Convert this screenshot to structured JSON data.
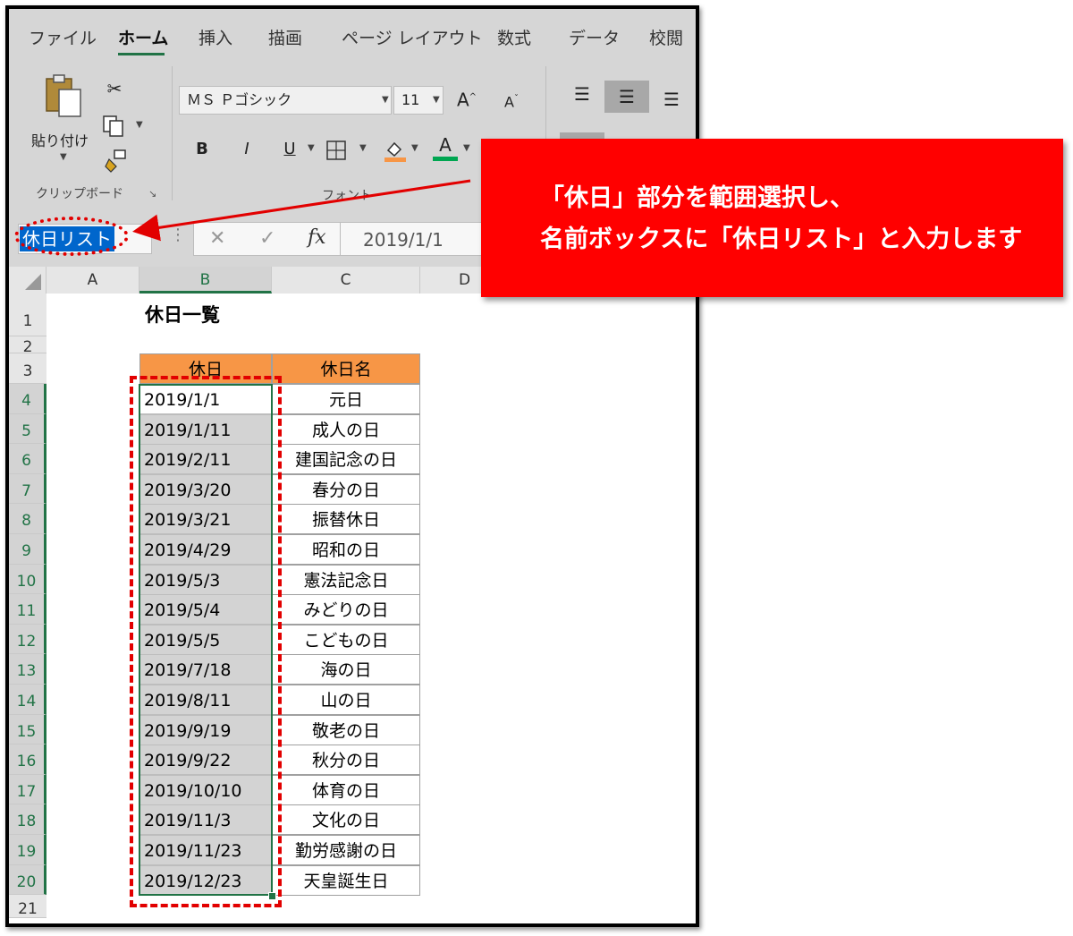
{
  "ribbon": {
    "tabs": [
      "ファイル",
      "ホーム",
      "挿入",
      "描画",
      "ページ レイアウト",
      "数式",
      "データ",
      "校閲"
    ],
    "active_tab": "ホーム",
    "clipboard": {
      "paste_label": "貼り付け",
      "group_label": "クリップボード"
    },
    "font": {
      "family": "ＭＳ Ｐゴシック",
      "size": "11",
      "group_label": "フォント",
      "bold": "B",
      "italic": "I",
      "underline": "U",
      "grow": "A",
      "shrink": "A",
      "font_color": "A"
    },
    "accent_color": "#217346"
  },
  "formula_bar": {
    "name_box": "休日リスト",
    "cancel": "✕",
    "enter": "✓",
    "fx": "fx",
    "formula": "2019/1/1"
  },
  "sheet": {
    "columns": [
      "A",
      "B",
      "C",
      "D"
    ],
    "rows": [
      "1",
      "2",
      "3",
      "4",
      "5",
      "6",
      "7",
      "8",
      "9",
      "10",
      "11",
      "12",
      "13",
      "14",
      "15",
      "16",
      "17",
      "18",
      "19",
      "20",
      "21"
    ],
    "title": "休日一覧",
    "headers": {
      "date": "休日",
      "name": "休日名"
    },
    "header_color": "#f79646",
    "holidays": [
      {
        "date": "2019/1/1",
        "name": "元日"
      },
      {
        "date": "2019/1/11",
        "name": "成人の日"
      },
      {
        "date": "2019/2/11",
        "name": "建国記念の日"
      },
      {
        "date": "2019/3/20",
        "name": "春分の日"
      },
      {
        "date": "2019/3/21",
        "name": "振替休日"
      },
      {
        "date": "2019/4/29",
        "name": "昭和の日"
      },
      {
        "date": "2019/5/3",
        "name": "憲法記念日"
      },
      {
        "date": "2019/5/4",
        "name": "みどりの日"
      },
      {
        "date": "2019/5/5",
        "name": "こどもの日"
      },
      {
        "date": "2019/7/18",
        "name": "海の日"
      },
      {
        "date": "2019/8/11",
        "name": "山の日"
      },
      {
        "date": "2019/9/19",
        "name": "敬老の日"
      },
      {
        "date": "2019/9/22",
        "name": "秋分の日"
      },
      {
        "date": "2019/10/10",
        "name": "体育の日"
      },
      {
        "date": "2019/11/3",
        "name": "文化の日"
      },
      {
        "date": "2019/11/23",
        "name": "勤労感謝の日"
      },
      {
        "date": "2019/12/23",
        "name": "天皇誕生日"
      }
    ]
  },
  "callout": {
    "line1": "「休日」部分を範囲選択し、",
    "line2": "名前ボックスに「休日リスト」と入力します",
    "color": "#ff0000"
  }
}
